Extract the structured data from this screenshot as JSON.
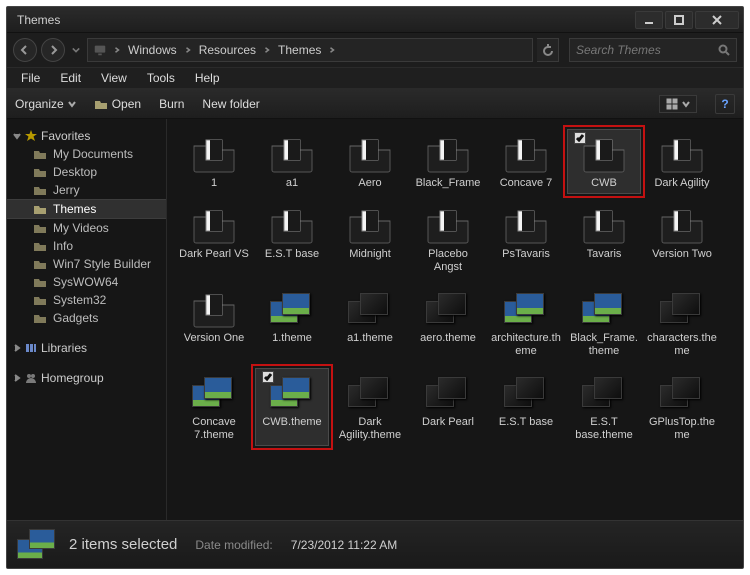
{
  "window": {
    "title": "Themes"
  },
  "nav": {
    "crumbs": [
      "Windows",
      "Resources",
      "Themes"
    ],
    "search_placeholder": "Search Themes"
  },
  "menu": {
    "items": [
      "File",
      "Edit",
      "View",
      "Tools",
      "Help"
    ]
  },
  "cmd": {
    "organize": "Organize",
    "open": "Open",
    "burn": "Burn",
    "newfolder": "New folder"
  },
  "sidebar": {
    "favorites_label": "Favorites",
    "favorites": [
      "My Documents",
      "Desktop",
      "Jerry",
      "Themes",
      "My Videos",
      "Info",
      "Win7 Style Builder",
      "SysWOW64",
      "System32",
      "Gadgets"
    ],
    "favorites_active_index": 3,
    "libraries_label": "Libraries",
    "homegroup_label": "Homegroup"
  },
  "items": [
    {
      "name": "1",
      "type": "folder"
    },
    {
      "name": "a1",
      "type": "folder"
    },
    {
      "name": "Aero",
      "type": "folder"
    },
    {
      "name": "Black_Frame",
      "type": "folder"
    },
    {
      "name": "Concave 7",
      "type": "folder"
    },
    {
      "name": "CWB",
      "type": "folder",
      "selected": true,
      "highlighted": true
    },
    {
      "name": "Dark Agility",
      "type": "folder"
    },
    {
      "name": "Dark Pearl VS",
      "type": "folder"
    },
    {
      "name": "E.S.T base",
      "type": "folder"
    },
    {
      "name": "Midnight",
      "type": "folder"
    },
    {
      "name": "Placebo Angst",
      "type": "folder"
    },
    {
      "name": "PsTavaris",
      "type": "folder"
    },
    {
      "name": "Tavaris",
      "type": "folder"
    },
    {
      "name": "Version Two",
      "type": "folder"
    },
    {
      "name": "Version One",
      "type": "folder"
    },
    {
      "name": "1.theme",
      "type": "theme-blue"
    },
    {
      "name": "a1.theme",
      "type": "theme"
    },
    {
      "name": "aero.theme",
      "type": "theme"
    },
    {
      "name": "architecture.theme",
      "type": "theme-blue"
    },
    {
      "name": "Black_Frame.theme",
      "type": "theme-blue"
    },
    {
      "name": "characters.theme",
      "type": "theme"
    },
    {
      "name": "Concave 7.theme",
      "type": "theme-blue"
    },
    {
      "name": "CWB.theme",
      "type": "theme-blue",
      "selected": true,
      "highlighted": true
    },
    {
      "name": "Dark Agility.theme",
      "type": "theme"
    },
    {
      "name": "Dark Pearl",
      "type": "theme"
    },
    {
      "name": "E.S.T base",
      "type": "theme"
    },
    {
      "name": "E.S.T base.theme",
      "type": "theme"
    },
    {
      "name": "GPlusTop.theme",
      "type": "theme"
    }
  ],
  "status": {
    "count_text": "2 items selected",
    "date_label": "Date modified:",
    "date_value": "7/23/2012 11:22 AM"
  }
}
